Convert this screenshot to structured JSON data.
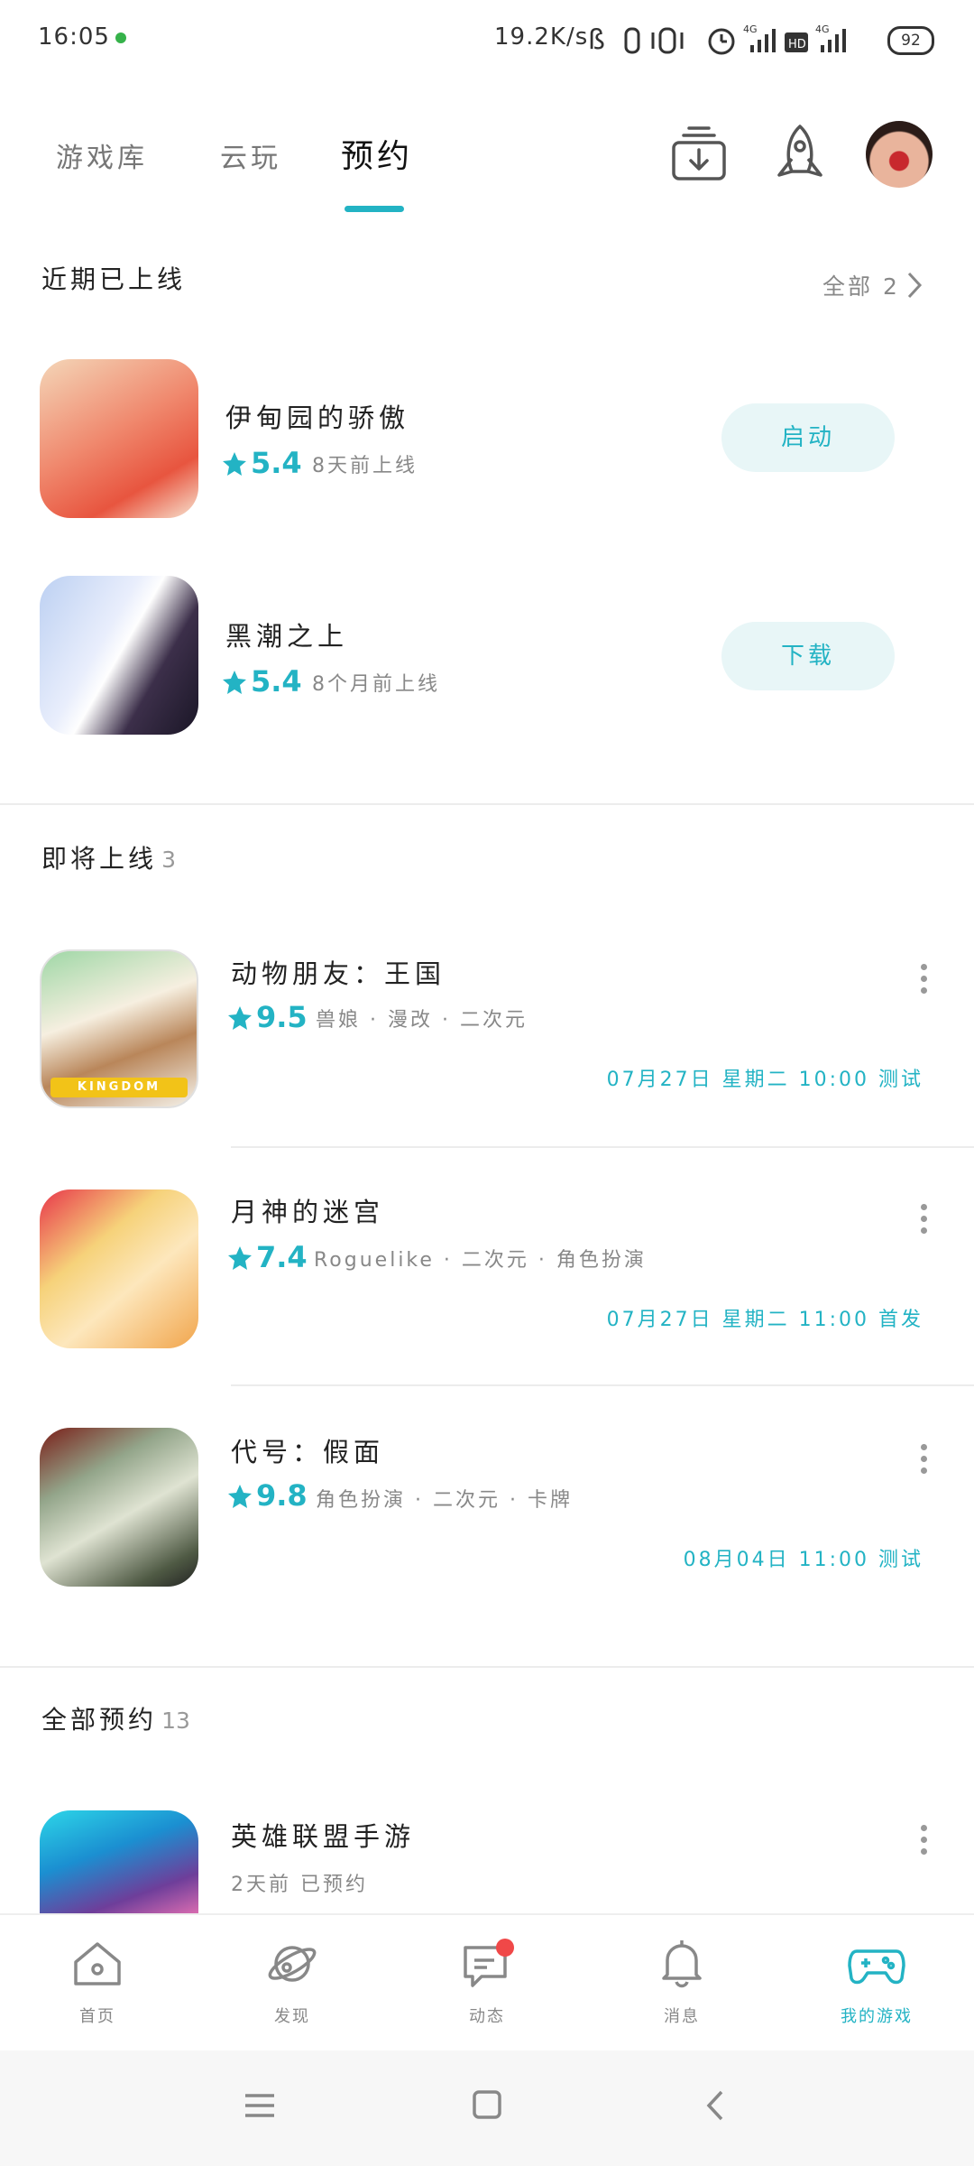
{
  "status_bar": {
    "time": "16:05",
    "speed": "19.2K/s",
    "battery": "92"
  },
  "tabs": [
    {
      "label": "游戏库"
    },
    {
      "label": "云玩"
    },
    {
      "label": "预约"
    }
  ],
  "recent": {
    "title": "近期已上线",
    "all_label": "全部 2",
    "games": [
      {
        "name": "伊甸园的骄傲",
        "rating": "5.4",
        "meta": "8天前上线",
        "action": "启动"
      },
      {
        "name": "黑潮之上",
        "rating": "5.4",
        "meta": "8个月前上线",
        "action": "下载"
      }
    ]
  },
  "upcoming": {
    "title": "即将上线",
    "count": "3",
    "games": [
      {
        "name": "动物朋友：王国",
        "rating": "9.5",
        "tags": "兽娘 · 漫改 · 二次元",
        "date": "07月27日 星期二 10:00 测试",
        "icon_text": "KINGDOM"
      },
      {
        "name": "月神的迷宫",
        "rating": "7.4",
        "tags": "Roguelike · 二次元 · 角色扮演",
        "date": "07月27日 星期二 11:00 首发"
      },
      {
        "name": "代号：假面",
        "rating": "9.8",
        "tags": "角色扮演 · 二次元 · 卡牌",
        "date": "08月04日 11:00 测试"
      }
    ]
  },
  "all_reserved": {
    "title": "全部预约",
    "count": "13",
    "games": [
      {
        "name": "英雄联盟手游",
        "meta": "2天前 已预约"
      }
    ]
  },
  "bottom_nav": [
    {
      "label": "首页",
      "icon": "home-icon"
    },
    {
      "label": "发现",
      "icon": "planet-icon"
    },
    {
      "label": "动态",
      "icon": "chat-icon"
    },
    {
      "label": "消息",
      "icon": "bell-icon"
    },
    {
      "label": "我的游戏",
      "icon": "gamepad-icon"
    }
  ],
  "colors": {
    "accent": "#23b3c4",
    "badge": "#f04848"
  }
}
